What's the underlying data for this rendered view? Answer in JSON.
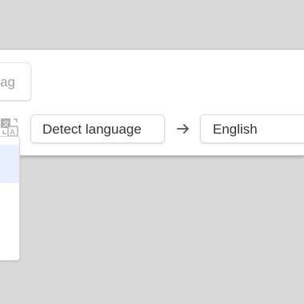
{
  "image_button": {
    "partial_label": "ag"
  },
  "language_bar": {
    "source_label": "Detect language",
    "target_label": "English",
    "arrow_icon": "arrow-right-icon",
    "swap_icon": "translate-swap-icon"
  },
  "colors": {
    "background": "#d9d9d9",
    "panel": "#ffffff",
    "selected_item": "#e8f0fe",
    "icon_gray": "#9e9e9e",
    "text": "#333333"
  }
}
